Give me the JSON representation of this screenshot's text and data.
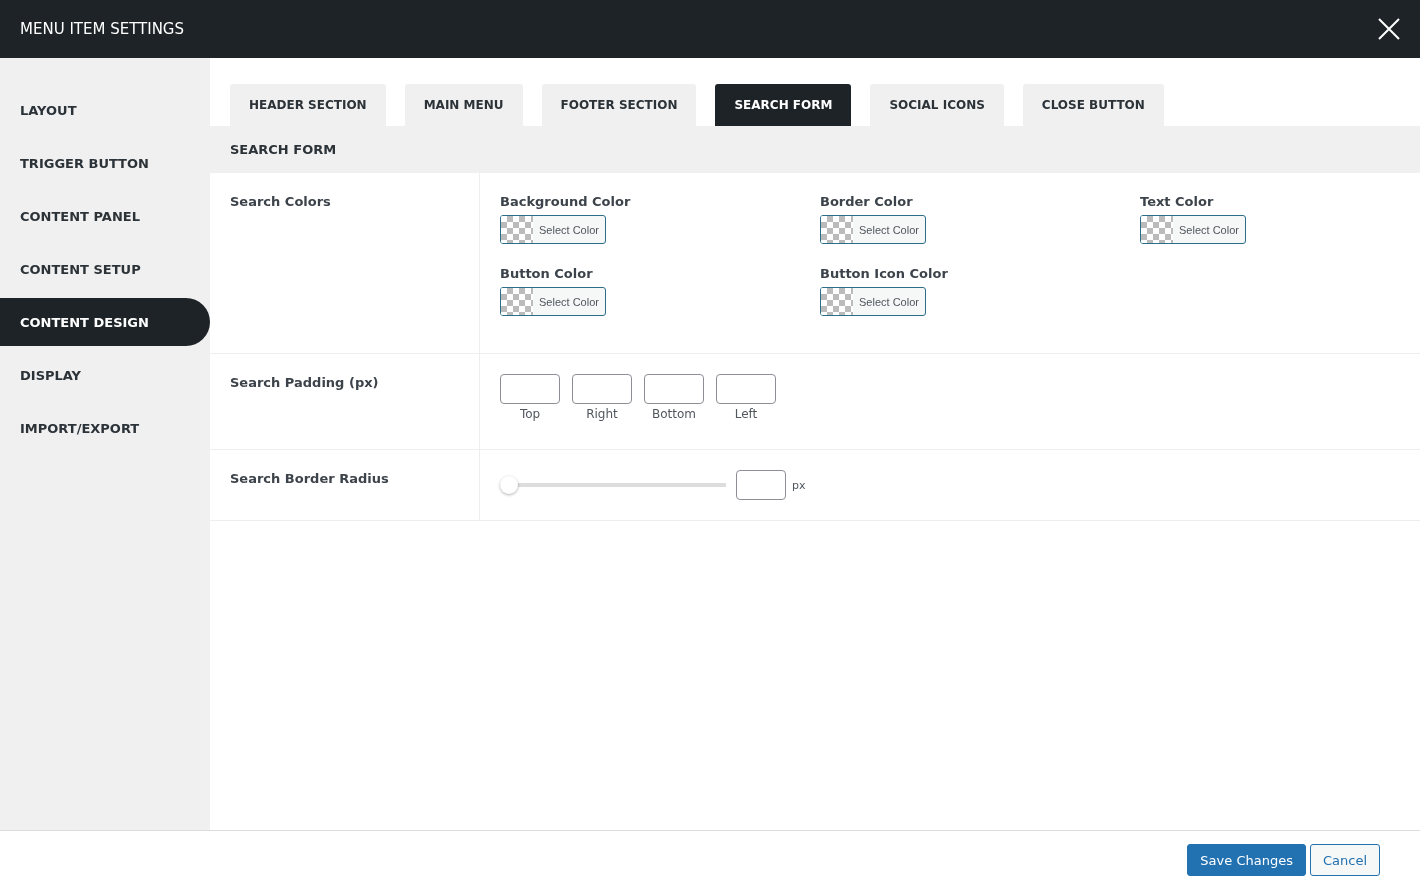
{
  "window": {
    "title": "MENU ITEM SETTINGS"
  },
  "sidebar": {
    "items": [
      {
        "label": "LAYOUT",
        "selected": false
      },
      {
        "label": "TRIGGER BUTTON",
        "selected": false
      },
      {
        "label": "CONTENT PANEL",
        "selected": false
      },
      {
        "label": "CONTENT SETUP",
        "selected": false
      },
      {
        "label": "CONTENT DESIGN",
        "selected": true
      },
      {
        "label": "DISPLAY",
        "selected": false
      },
      {
        "label": "IMPORT/EXPORT",
        "selected": false
      }
    ]
  },
  "tabs": [
    {
      "label": "HEADER SECTION",
      "selected": false
    },
    {
      "label": "MAIN MENU",
      "selected": false
    },
    {
      "label": "FOOTER SECTION",
      "selected": false
    },
    {
      "label": "SEARCH FORM",
      "selected": true
    },
    {
      "label": "SOCIAL ICONS",
      "selected": false
    },
    {
      "label": "CLOSE BUTTON",
      "selected": false
    }
  ],
  "section_title": "SEARCH FORM",
  "search_colors": {
    "label": "Search Colors",
    "pickers": [
      {
        "label": "Background Color",
        "button": "Select Color"
      },
      {
        "label": "Border Color",
        "button": "Select Color"
      },
      {
        "label": "Text Color",
        "button": "Select Color"
      },
      {
        "label": "Button Color",
        "button": "Select Color"
      },
      {
        "label": "Button Icon Color",
        "button": "Select Color"
      }
    ]
  },
  "search_padding": {
    "label": "Search Padding (px)",
    "fields": [
      {
        "caption": "Top"
      },
      {
        "caption": "Right"
      },
      {
        "caption": "Bottom"
      },
      {
        "caption": "Left"
      }
    ]
  },
  "search_border_radius": {
    "label": "Search Border Radius",
    "level": 0,
    "unit": "px"
  },
  "footer": {
    "save": "Save Changes",
    "cancel": "Cancel"
  }
}
